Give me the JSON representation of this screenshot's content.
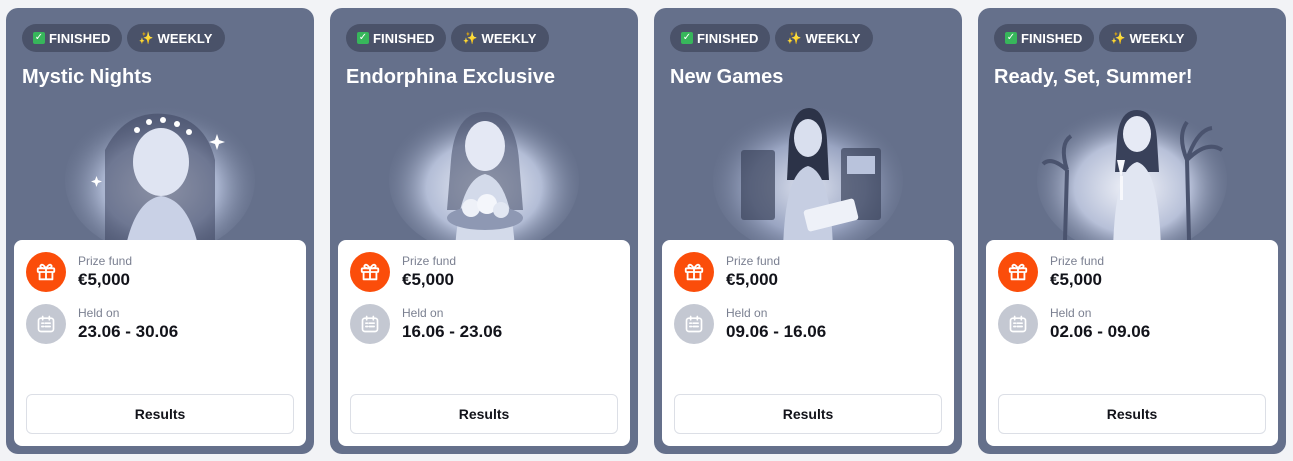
{
  "colors": {
    "card_bg": "#65708b",
    "badge_bg": "#4a5269",
    "prize_icon_bg": "#fb4d0a",
    "held_icon_bg": "#c4c8d2",
    "check_green": "#37b65b"
  },
  "badges": {
    "status": {
      "icon": "check-icon",
      "label": "FINISHED"
    },
    "period": {
      "icon": "sparkles-icon",
      "label": "WEEKLY"
    }
  },
  "labels": {
    "prize_fund": "Prize fund",
    "held_on": "Held on",
    "results_button": "Results"
  },
  "cards": [
    {
      "title": "Mystic Nights",
      "art": "fairy-woman-portrait",
      "prize": "€5,000",
      "dates": "23.06 - 30.06"
    },
    {
      "title": "Endorphina Exclusive",
      "art": "woman-with-fruit-bowl",
      "prize": "€5,000",
      "dates": "16.06 - 23.06"
    },
    {
      "title": "New Games",
      "art": "woman-with-slot-machines",
      "prize": "€5,000",
      "dates": "09.06 - 16.06"
    },
    {
      "title": "Ready, Set, Summer!",
      "art": "woman-with-cocktail",
      "prize": "€5,000",
      "dates": "02.06 - 09.06"
    }
  ]
}
